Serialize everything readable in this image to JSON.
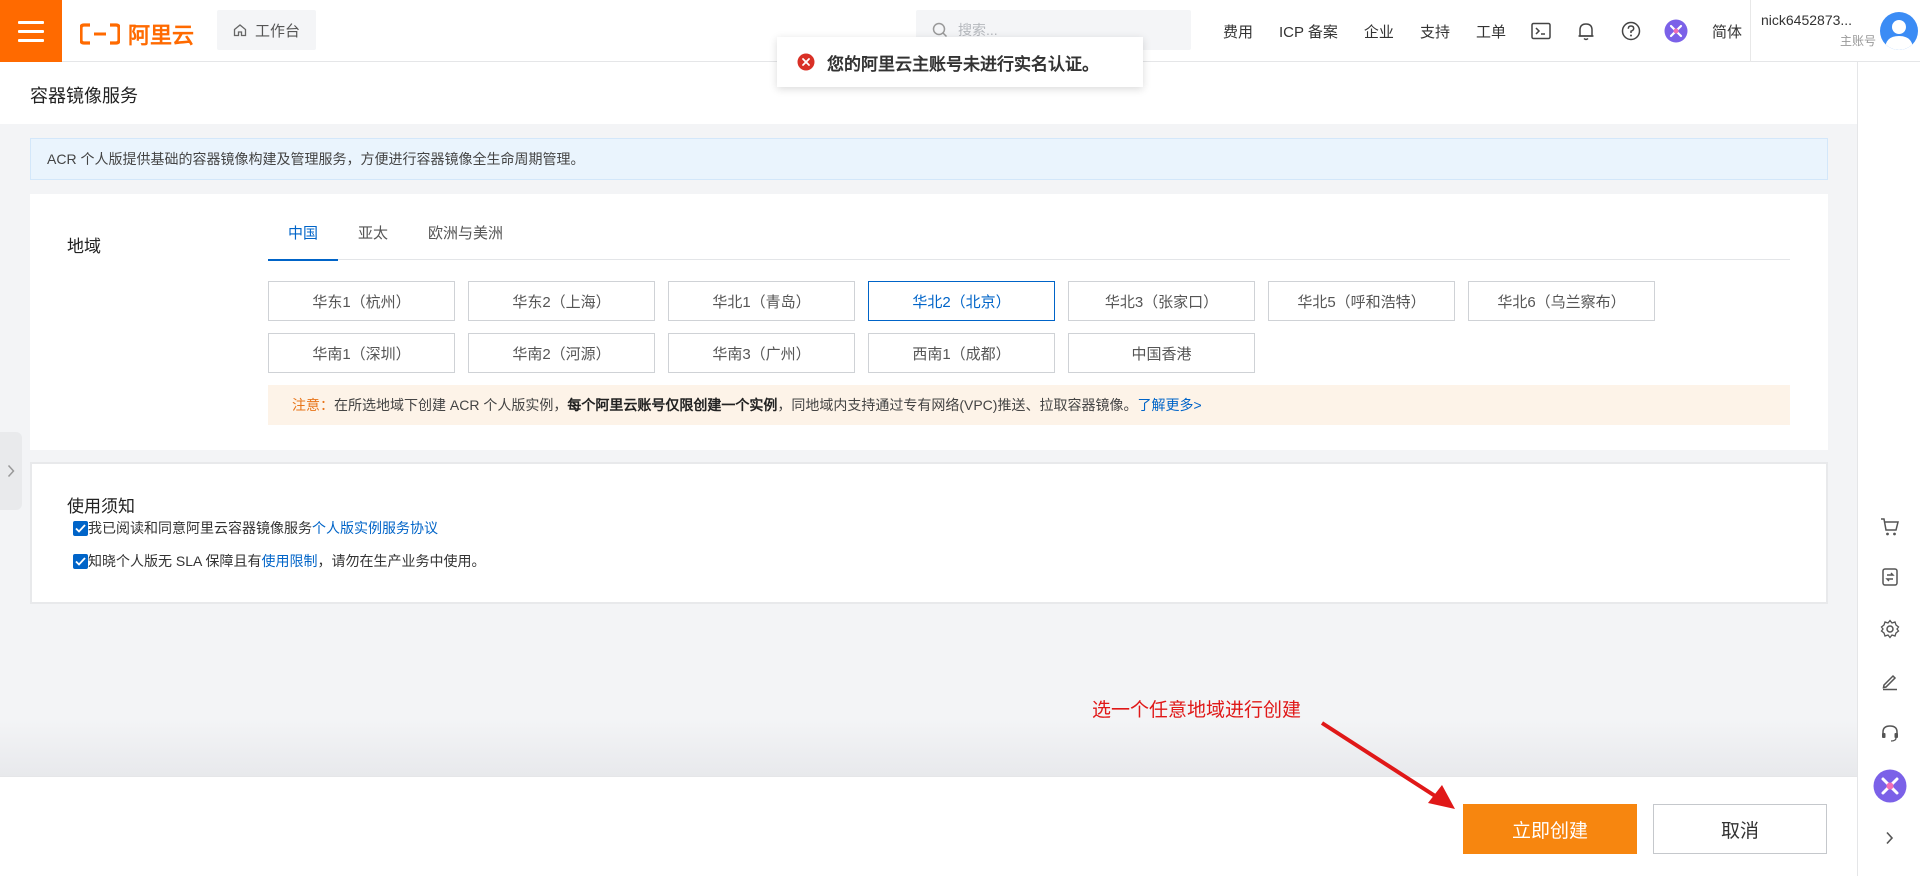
{
  "topbar": {
    "logo_text": "阿里云",
    "workbench_label": "工作台",
    "search_placeholder": "搜索...",
    "nav_items": [
      "费用",
      "ICP 备案",
      "企业",
      "支持",
      "工单"
    ],
    "language": "简体",
    "user_name": "nick6452873...",
    "user_role": "主账号",
    "icons": [
      "terminal-icon",
      "bell-icon",
      "help-icon",
      "ai-assistant-icon"
    ]
  },
  "toast": {
    "message": "您的阿里云主账号未进行实名认证。",
    "type": "error"
  },
  "page": {
    "title": "容器镜像服务",
    "info": "ACR 个人版提供基础的容器镜像构建及管理服务，方便进行容器镜像全生命周期管理。"
  },
  "region": {
    "label": "地域",
    "tabs": [
      "中国",
      "亚太",
      "欧洲与美洲"
    ],
    "active_tab": "中国",
    "rows": [
      [
        "华东1（杭州）",
        "华东2（上海）",
        "华北1（青岛）",
        "华北2（北京）",
        "华北3（张家口）",
        "华北5（呼和浩特）",
        "华北6（乌兰察布）"
      ],
      [
        "华南1（深圳）",
        "华南2（河源）",
        "华南3（广州）",
        "西南1（成都）",
        "中国香港"
      ]
    ],
    "selected": "华北2（北京）",
    "notice": {
      "head": "注意：",
      "part1": "在所选地域下创建 ACR 个人版实例，",
      "bold": "每个阿里云账号仅限创建一个实例",
      "part2": "，同地域内支持通过专有网络(VPC)推送、拉取容器镜像。",
      "link": "了解更多>"
    }
  },
  "terms": {
    "title": "使用须知",
    "item1_text": "我已阅读和同意阿里云容器镜像服务",
    "item1_link": "个人版实例服务协议",
    "item1_checked": true,
    "item2_text": "知晓个人版无 SLA 保障且有",
    "item2_link": "使用限制",
    "item2_suffix": "，请勿在生产业务中使用。",
    "item2_checked": true
  },
  "footer": {
    "create_label": "立即创建",
    "cancel_label": "取消"
  },
  "annotation": {
    "text": "选一个任意地域进行创建",
    "color": "#e01818"
  },
  "rail": {
    "icons": [
      "cart-icon",
      "switch-icon",
      "settings-icon",
      "edit-icon",
      "headset-icon",
      "ai-assistant-icon",
      "chevron-right-icon"
    ]
  },
  "colors": {
    "brand": "#ff6a00",
    "primary": "#0064c8",
    "create_button": "#f7860f"
  }
}
